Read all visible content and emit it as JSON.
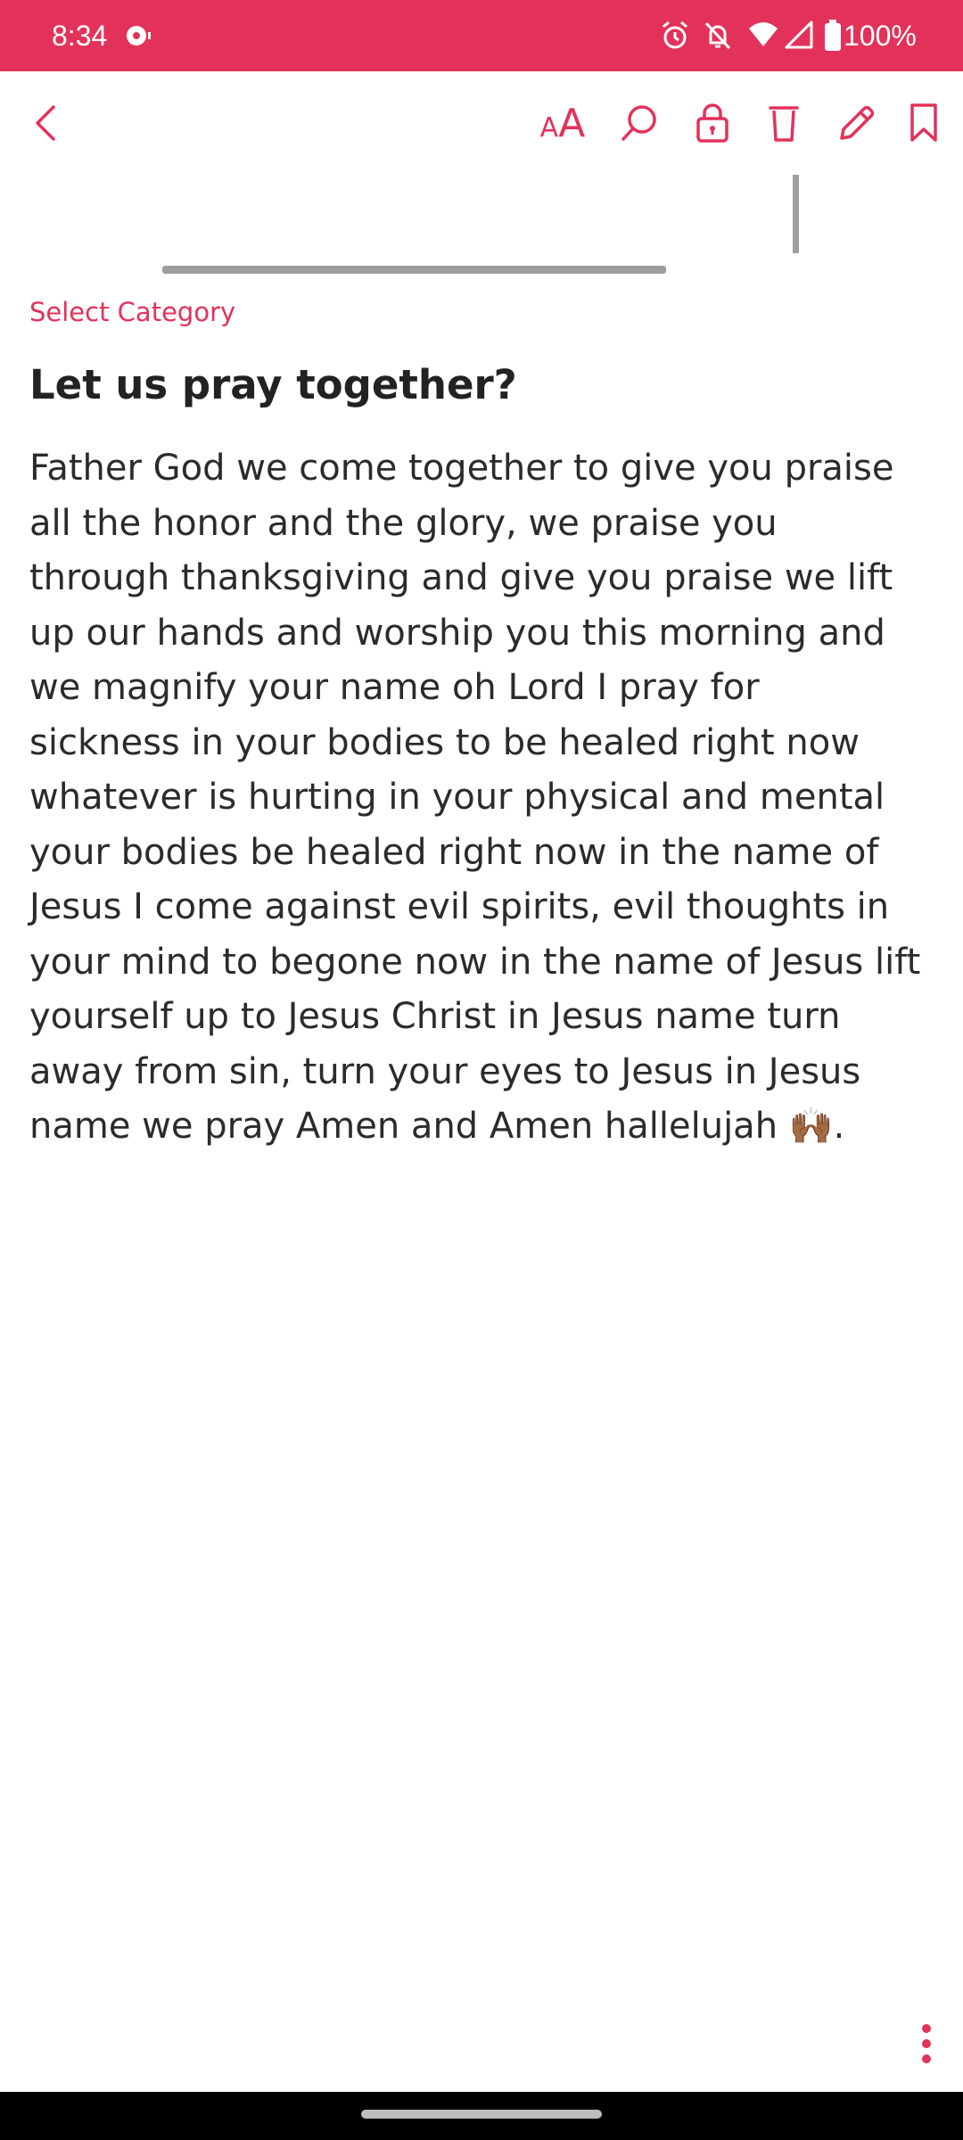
{
  "status_bar": {
    "time": "8:34",
    "battery": "100%",
    "background_color": "#e3325a",
    "icons": [
      "chat-notification-icon",
      "alarm-icon",
      "notifications-off-icon",
      "wifi-icon",
      "cell-signal-icon",
      "battery-icon"
    ]
  },
  "toolbar": {
    "accent_color": "#e3325a",
    "font_size_small": "A",
    "font_size_big": "A",
    "icons": [
      "back-arrow-icon",
      "font-size-icon",
      "search-icon",
      "lock-icon",
      "delete-icon",
      "edit-pencil-icon",
      "bookmark-icon"
    ]
  },
  "note": {
    "category": "Select Category",
    "title": "Let us pray together?",
    "body": "Father God we come together to give you praise all the honor and the glory, we praise you through thanksgiving and give you praise we lift up our hands and worship you this morning and we magnify your name oh Lord I pray for sickness in your bodies to be healed right now whatever is hurting in your physical and mental your bodies be healed right now in the name of Jesus I come against evil spirits, evil thoughts in your mind to begone now in the name of Jesus lift yourself up to Jesus Christ in Jesus name turn away from sin, turn your eyes to Jesus in Jesus name we pray Amen and Amen hallelujah 🙌🏾."
  },
  "bottom": {
    "more_menu_icon": "more-vertical-icon"
  }
}
